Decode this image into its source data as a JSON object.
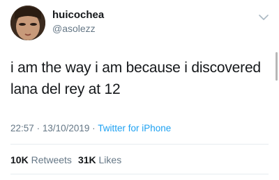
{
  "author": {
    "display_name": "huicochea",
    "handle": "@asolezz"
  },
  "tweet": {
    "text_line1": "i am the way i am because i discovered",
    "text_line2": "lana del rey at 12"
  },
  "meta": {
    "time": "22:57",
    "separator1": "·",
    "date": "13/10/2019",
    "separator2": "·",
    "source": "Twitter for iPhone"
  },
  "stats": {
    "retweets_count": "10K",
    "retweets_label": "Retweets",
    "likes_count": "31K",
    "likes_label": "Likes"
  },
  "icons": {
    "menu": "chevron-down-icon"
  },
  "colors": {
    "text": "#14171a",
    "secondary": "#657786",
    "link": "#1da1f2",
    "divider": "#e6ecf0"
  }
}
